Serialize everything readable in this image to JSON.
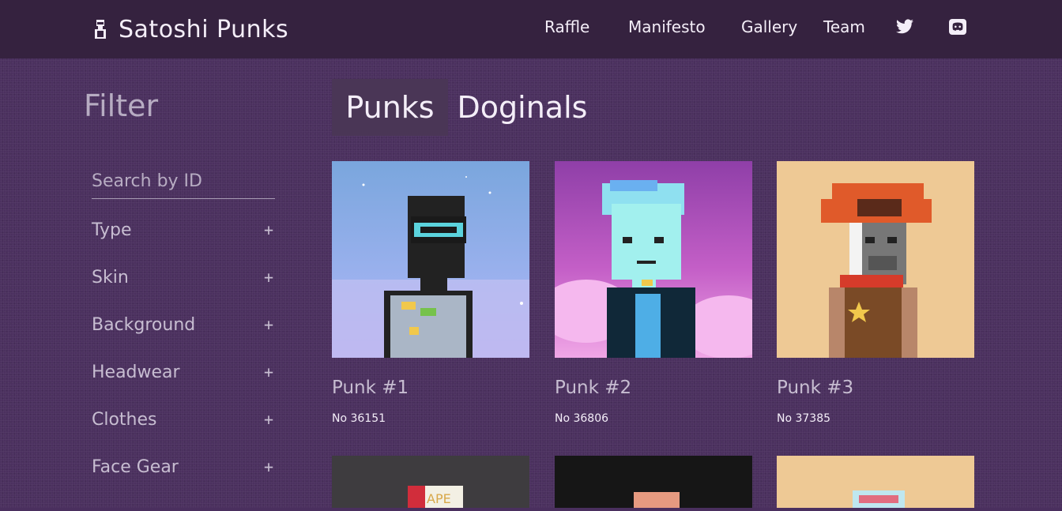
{
  "brand": {
    "name": "Satoshi Punks"
  },
  "nav": [
    {
      "label": "Raffle"
    },
    {
      "label": "Manifesto"
    },
    {
      "label": "Gallery"
    },
    {
      "label": "Team"
    }
  ],
  "social": {
    "twitter": "twitter-icon",
    "discord": "discord-icon"
  },
  "sidebar": {
    "title": "Filter",
    "search_placeholder": "Search by ID",
    "facets": [
      {
        "label": "Type"
      },
      {
        "label": "Skin"
      },
      {
        "label": "Background"
      },
      {
        "label": "Headwear"
      },
      {
        "label": "Clothes"
      },
      {
        "label": "Face Gear"
      }
    ],
    "expand_symbol": "+"
  },
  "tabs": [
    {
      "label": "Punks",
      "active": true
    },
    {
      "label": "Doginals",
      "active": false
    }
  ],
  "cards": [
    {
      "title": "Punk #1",
      "number": "No 36151"
    },
    {
      "title": "Punk #2",
      "number": "No 36806"
    },
    {
      "title": "Punk #3",
      "number": "No 37385"
    }
  ],
  "next_row_labels": [
    "APE"
  ],
  "colors": {
    "header_bg": "#35223f",
    "page_bg": "#4b305f",
    "text": "#f4eef8",
    "muted": "#c7bdd1"
  }
}
